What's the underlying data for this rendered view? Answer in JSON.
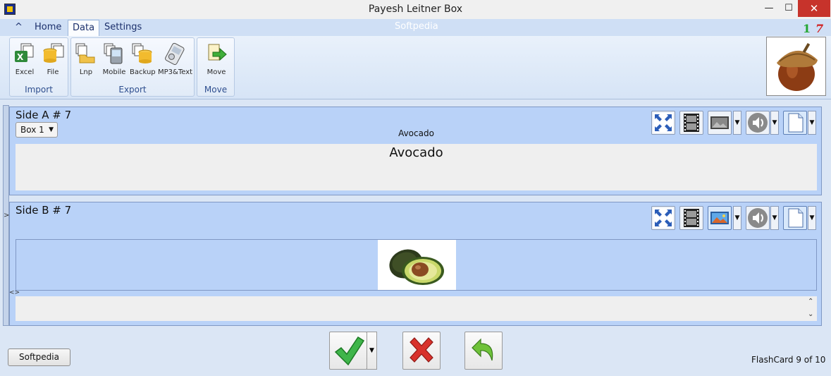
{
  "window": {
    "title": "Payesh Leitner Box",
    "minimize": "—",
    "maximize": "☐",
    "close": "✕"
  },
  "tabs": {
    "collapse": "^",
    "home": "Home",
    "data": "Data",
    "settings": "Settings"
  },
  "watermark": "Softpedia",
  "counters": {
    "a": "1",
    "b": "7"
  },
  "ribbon": {
    "groups": {
      "import": {
        "label": "Import",
        "buttons": [
          "Excel",
          "File"
        ]
      },
      "export": {
        "label": "Export",
        "buttons": [
          "Lnp",
          "Mobile",
          "Backup",
          "MP3&Text"
        ]
      },
      "move": {
        "label": "Move",
        "buttons": [
          "Move"
        ]
      }
    }
  },
  "side_a": {
    "title": "Side A # 7",
    "box": "Box 1",
    "small_text": "Avocado",
    "front_text": "Avocado"
  },
  "side_b": {
    "title": "Side B # 7"
  },
  "bottom": {
    "softpedia_button": "Softpedia",
    "status": "FlashCard 9 of 10"
  },
  "colors": {
    "panel": "#b9d2f8",
    "accent_green": "#24a632",
    "accent_red": "#d02020"
  }
}
